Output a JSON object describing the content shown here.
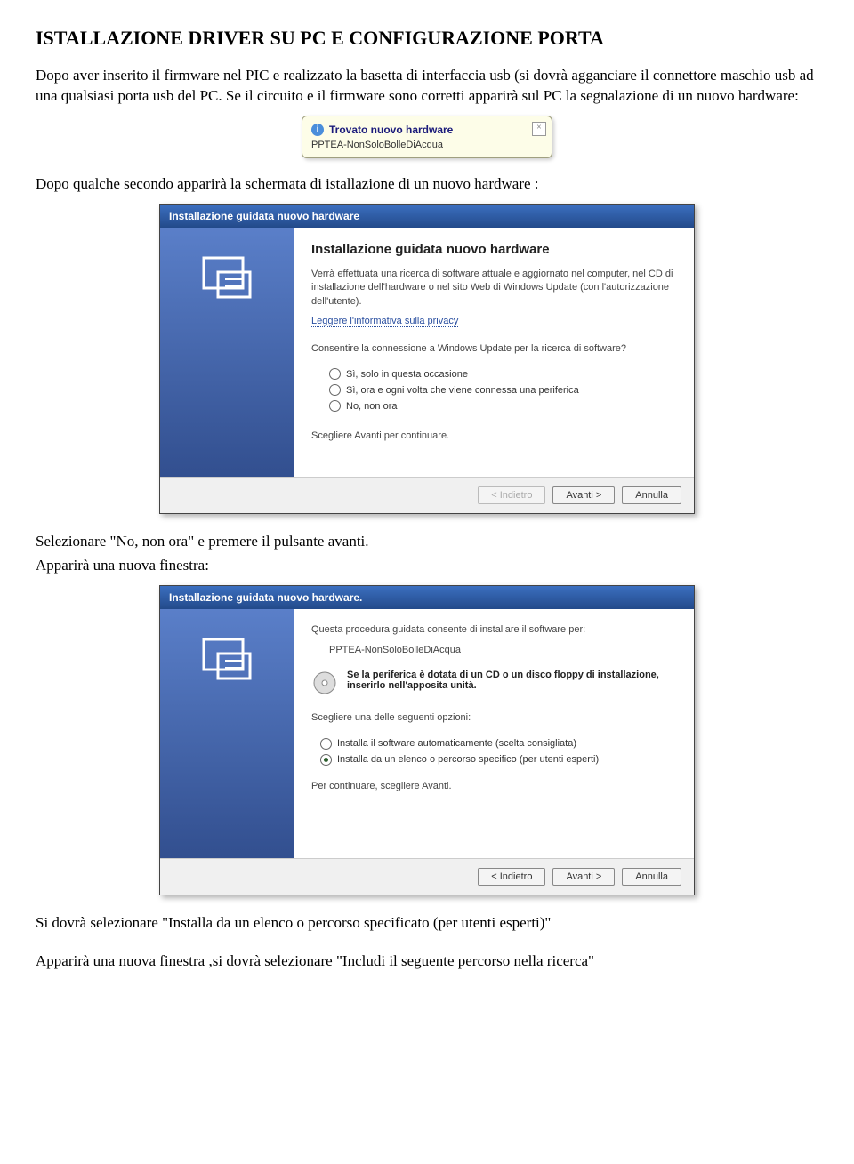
{
  "title": "ISTALLAZIONE DRIVER SU PC E CONFIGURAZIONE PORTA",
  "para1": "Dopo aver inserito il firmware nel PIC e realizzato la basetta di interfaccia usb (si dovrà agganciare il connettore maschio usb ad una qualsiasi porta usb del PC. Se il circuito e il firmware sono corretti apparirà sul PC la segnalazione di un nuovo hardware:",
  "balloon": {
    "title": "Trovato nuovo hardware",
    "sub": "PPTEA-NonSoloBolleDiAcqua"
  },
  "para2": "Dopo qualche secondo apparirà la schermata di istallazione di un nuovo hardware :",
  "wiz1": {
    "titlebar": "Installazione guidata nuovo hardware",
    "heading": "Installazione guidata nuovo hardware",
    "desc": "Verrà effettuata una ricerca di software attuale e aggiornato nel computer, nel CD di installazione dell'hardware o nel sito Web di Windows Update (con l'autorizzazione dell'utente).",
    "privacy": "Leggere l'informativa sulla privacy",
    "question": "Consentire la connessione a Windows Update per la ricerca di software?",
    "opt1": "Sì, solo in questa occasione",
    "opt2": "Sì, ora e ogni volta che viene connessa una periferica",
    "opt3": "No, non ora",
    "continue": "Scegliere Avanti per continuare.",
    "back": "< Indietro",
    "next": "Avanti >",
    "cancel": "Annulla"
  },
  "para3": "Selezionare \"No, non ora\" e premere il pulsante avanti.",
  "para4": "Apparirà una nuova finestra:",
  "wiz2": {
    "titlebar": "Installazione guidata nuovo hardware.",
    "desc": "Questa procedura guidata consente di installare il software per:",
    "device": "PPTEA-NonSoloBolleDiAcqua",
    "cd": "Se la periferica è dotata di un CD o un disco floppy di installazione, inserirlo nell'apposita unità.",
    "choose": "Scegliere una delle seguenti opzioni:",
    "optA": "Installa il software automaticamente (scelta consigliata)",
    "optB": "Installa da un elenco o percorso specifico (per utenti esperti)",
    "continue": "Per continuare, scegliere Avanti.",
    "back": "< Indietro",
    "next": "Avanti >",
    "cancel": "Annulla"
  },
  "para5": "Si dovrà selezionare \"Installa da un elenco o percorso specificato (per utenti esperti)\"",
  "para6": "Apparirà una nuova finestra ,si dovrà selezionare  \"Includi il seguente percorso nella ricerca\""
}
